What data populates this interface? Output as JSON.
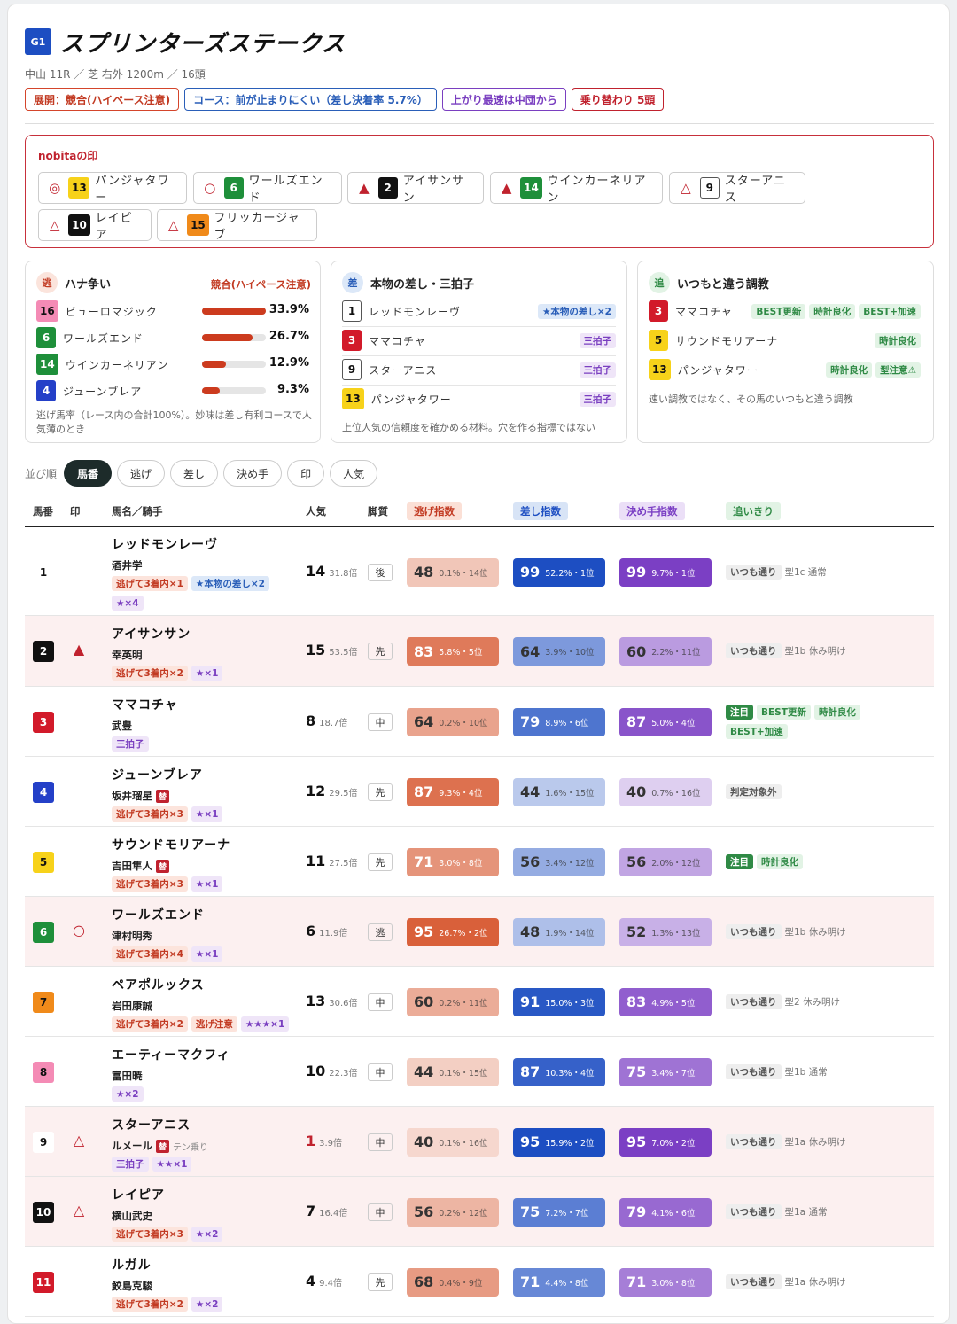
{
  "race": {
    "grade": "G1",
    "title": "スプリンターズステークス",
    "sub": "中山 11R ／ 芝 右外 1200m ／ 16頭"
  },
  "badges": [
    {
      "label": "展開：競合(ハイペース注意)"
    },
    {
      "label": "コース：前が止まりにくい（差し決着率 5.7%）"
    },
    {
      "label": "上がり最速は中団から"
    },
    {
      "label": "乗り替わり 5頭"
    }
  ],
  "marks": {
    "title": "nobitaの印",
    "items": [
      {
        "sym": "◎",
        "no": "13",
        "name": "パンジャタワー"
      },
      {
        "sym": "○",
        "no": "6",
        "name": "ワールズエンド"
      },
      {
        "sym": "▲",
        "no": "2",
        "name": "アイサンサン"
      },
      {
        "sym": "▲",
        "no": "14",
        "name": "ウインカーネリアン"
      },
      {
        "sym": "△",
        "no": "9",
        "name": "スターアニス"
      },
      {
        "sym": "△",
        "no": "10",
        "name": "レイピア"
      },
      {
        "sym": "△",
        "no": "15",
        "name": "フリッカージャブ"
      }
    ]
  },
  "card1": {
    "icon": "逃",
    "title": "ハナ争い",
    "status": "競合(ハイペース注意)",
    "rows": [
      {
        "no": "16",
        "name": "ビューロマジック",
        "pct": "33.9%",
        "v": 0.339
      },
      {
        "no": "6",
        "name": "ワールズエンド",
        "pct": "26.7%",
        "v": 0.267
      },
      {
        "no": "14",
        "name": "ウインカーネリアン",
        "pct": "12.9%",
        "v": 0.129
      },
      {
        "no": "4",
        "name": "ジューンブレア",
        "pct": "9.3%",
        "v": 0.093
      }
    ],
    "note": "逃げ馬率（レース内の合計100%）。妙味は差し有利コースで人気薄のとき"
  },
  "card2": {
    "icon": "差",
    "title": "本物の差し・三拍子",
    "rows": [
      {
        "no": "1",
        "name": "レッドモンレーヴ",
        "tag": "★本物の差し×2"
      },
      {
        "no": "3",
        "name": "ママコチャ",
        "tag": "三拍子"
      },
      {
        "no": "9",
        "name": "スターアニス",
        "tag": "三拍子"
      },
      {
        "no": "13",
        "name": "パンジャタワー",
        "tag": "三拍子"
      }
    ],
    "note": "上位人気の信頼度を確かめる材料。穴を作る指標ではない"
  },
  "card3": {
    "icon": "追",
    "title": "いつもと違う調教",
    "rows": [
      {
        "no": "3",
        "name": "ママコチャ",
        "tags": [
          "BEST更新",
          "時計良化",
          "BEST+加速"
        ]
      },
      {
        "no": "5",
        "name": "サウンドモリアーナ",
        "tags": [
          "時計良化"
        ]
      },
      {
        "no": "13",
        "name": "パンジャタワー",
        "tags": [
          "時計良化",
          "型注意⚠"
        ]
      }
    ],
    "note": "速い調教ではなく、その馬のいつもと違う調教"
  },
  "sort": {
    "label": "並び順",
    "options": [
      "馬番",
      "逃げ",
      "差し",
      "決め手",
      "印",
      "人気"
    ]
  },
  "table": {
    "headers": {
      "no": "馬番",
      "mark": "印",
      "name": "馬名／騎手",
      "pop": "人気",
      "leg": "脚質",
      "nige": "逃げ指数",
      "sashi": "差し指数",
      "kime": "決め手指数",
      "oi": "追いきり"
    },
    "rows": [
      {
        "no": "1",
        "mark": "",
        "name": "レッドモンレーヴ",
        "jockey": "酒井学",
        "chg": "",
        "jnote": "",
        "tags": [
          [
            "逃げて3着内×1",
            "o"
          ],
          [
            "★本物の差し×2",
            "b"
          ],
          [
            "★×4",
            "p"
          ]
        ],
        "pop": "14",
        "odds": "31.8倍",
        "leg": "後",
        "nige": [
          "48",
          "0.1%・14位",
          0.48
        ],
        "sashi": [
          "99",
          "52.2%・1位",
          0.99
        ],
        "kime": [
          "99",
          "9.7%・1位",
          0.99
        ],
        "oi": [
          [
            "いつも通り",
            "g"
          ]
        ],
        "oinote": "型1c 通常"
      },
      {
        "no": "2",
        "mark": "▲",
        "name": "アイサンサン",
        "jockey": "幸英明",
        "chg": "",
        "jnote": "",
        "tags": [
          [
            "逃げて3着内×2",
            "o"
          ],
          [
            "★×1",
            "p"
          ]
        ],
        "pop": "15",
        "odds": "53.5倍",
        "leg": "先",
        "nige": [
          "83",
          "5.8%・5位",
          0.83
        ],
        "sashi": [
          "64",
          "3.9%・10位",
          0.64
        ],
        "kime": [
          "60",
          "2.2%・11位",
          0.6
        ],
        "oi": [
          [
            "いつも通り",
            "g"
          ]
        ],
        "oinote": "型1b 休み明け"
      },
      {
        "no": "3",
        "mark": "",
        "name": "ママコチャ",
        "jockey": "武豊",
        "chg": "",
        "jnote": "",
        "tags": [
          [
            "三拍子",
            "p"
          ]
        ],
        "pop": "8",
        "odds": "18.7倍",
        "leg": "中",
        "nige": [
          "64",
          "0.2%・10位",
          0.64
        ],
        "sashi": [
          "79",
          "8.9%・6位",
          0.79
        ],
        "kime": [
          "87",
          "5.0%・4位",
          0.87
        ],
        "oi": [
          [
            "注目",
            "G"
          ],
          [
            "BEST更新",
            "gr"
          ],
          [
            "時計良化",
            "gr"
          ],
          [
            "BEST+加速",
            "gr"
          ]
        ],
        "oinote": ""
      },
      {
        "no": "4",
        "mark": "",
        "name": "ジューンブレア",
        "jockey": "坂井瑠星",
        "chg": "替",
        "jnote": "",
        "tags": [
          [
            "逃げて3着内×3",
            "o"
          ],
          [
            "★×1",
            "p"
          ]
        ],
        "pop": "12",
        "odds": "29.5倍",
        "leg": "先",
        "nige": [
          "87",
          "9.3%・4位",
          0.87
        ],
        "sashi": [
          "44",
          "1.6%・15位",
          0.44
        ],
        "kime": [
          "40",
          "0.7%・16位",
          0.4
        ],
        "oi": [
          [
            "判定対象外",
            "g"
          ]
        ],
        "oinote": ""
      },
      {
        "no": "5",
        "mark": "",
        "name": "サウンドモリアーナ",
        "jockey": "吉田隼人",
        "chg": "替",
        "jnote": "",
        "tags": [
          [
            "逃げて3着内×3",
            "o"
          ],
          [
            "★×1",
            "p"
          ]
        ],
        "pop": "11",
        "odds": "27.5倍",
        "leg": "先",
        "nige": [
          "71",
          "3.0%・8位",
          0.71
        ],
        "sashi": [
          "56",
          "3.4%・12位",
          0.56
        ],
        "kime": [
          "56",
          "2.0%・12位",
          0.56
        ],
        "oi": [
          [
            "注目",
            "G"
          ],
          [
            "時計良化",
            "gr"
          ]
        ],
        "oinote": ""
      },
      {
        "no": "6",
        "mark": "○",
        "name": "ワールズエンド",
        "jockey": "津村明秀",
        "chg": "",
        "jnote": "",
        "tags": [
          [
            "逃げて3着内×4",
            "o"
          ],
          [
            "★×1",
            "p"
          ]
        ],
        "pop": "6",
        "odds": "11.9倍",
        "leg": "逃",
        "nige": [
          "95",
          "26.7%・2位",
          0.95
        ],
        "sashi": [
          "48",
          "1.9%・14位",
          0.48
        ],
        "kime": [
          "52",
          "1.3%・13位",
          0.52
        ],
        "oi": [
          [
            "いつも通り",
            "g"
          ]
        ],
        "oinote": "型1b 休み明け"
      },
      {
        "no": "7",
        "mark": "",
        "name": "ペアポルックス",
        "jockey": "岩田康誠",
        "chg": "",
        "jnote": "",
        "tags": [
          [
            "逃げて3着内×2",
            "o"
          ],
          [
            "逃げ注意",
            "o"
          ],
          [
            "★★★×1",
            "p"
          ]
        ],
        "pop": "13",
        "odds": "30.6倍",
        "leg": "中",
        "nige": [
          "60",
          "0.2%・11位",
          0.6
        ],
        "sashi": [
          "91",
          "15.0%・3位",
          0.91
        ],
        "kime": [
          "83",
          "4.9%・5位",
          0.83
        ],
        "oi": [
          [
            "いつも通り",
            "g"
          ]
        ],
        "oinote": "型2 休み明け"
      },
      {
        "no": "8",
        "mark": "",
        "name": "エーティーマクフィ",
        "jockey": "富田暁",
        "chg": "",
        "jnote": "",
        "tags": [
          [
            "★×2",
            "p"
          ]
        ],
        "pop": "10",
        "odds": "22.3倍",
        "leg": "中",
        "nige": [
          "44",
          "0.1%・15位",
          0.44
        ],
        "sashi": [
          "87",
          "10.3%・4位",
          0.87
        ],
        "kime": [
          "75",
          "3.4%・7位",
          0.75
        ],
        "oi": [
          [
            "いつも通り",
            "g"
          ]
        ],
        "oinote": "型1b 通常"
      },
      {
        "no": "9",
        "mark": "△",
        "name": "スターアニス",
        "jockey": "ルメール",
        "chg": "替",
        "jnote": "テン乗り",
        "tags": [
          [
            "三拍子",
            "p"
          ],
          [
            "★★×1",
            "p"
          ]
        ],
        "pop": "1",
        "odds": "3.9倍",
        "leg": "中",
        "nige": [
          "40",
          "0.1%・16位",
          0.4
        ],
        "sashi": [
          "95",
          "15.9%・2位",
          0.95
        ],
        "kime": [
          "95",
          "7.0%・2位",
          0.95
        ],
        "oi": [
          [
            "いつも通り",
            "g"
          ]
        ],
        "oinote": "型1a 休み明け"
      },
      {
        "no": "10",
        "mark": "△",
        "name": "レイピア",
        "jockey": "横山武史",
        "chg": "",
        "jnote": "",
        "tags": [
          [
            "逃げて3着内×3",
            "o"
          ],
          [
            "★×2",
            "p"
          ]
        ],
        "pop": "7",
        "odds": "16.4倍",
        "leg": "中",
        "nige": [
          "56",
          "0.2%・12位",
          0.56
        ],
        "sashi": [
          "75",
          "7.2%・7位",
          0.75
        ],
        "kime": [
          "79",
          "4.1%・6位",
          0.79
        ],
        "oi": [
          [
            "いつも通り",
            "g"
          ]
        ],
        "oinote": "型1a 通常"
      },
      {
        "no": "11",
        "mark": "",
        "name": "ルガル",
        "jockey": "鮫島克駿",
        "chg": "",
        "jnote": "",
        "tags": [
          [
            "逃げて3着内×2",
            "o"
          ],
          [
            "★×2",
            "p"
          ]
        ],
        "pop": "4",
        "odds": "9.4倍",
        "leg": "先",
        "nige": [
          "68",
          "0.4%・9位",
          0.68
        ],
        "sashi": [
          "71",
          "4.4%・8位",
          0.71
        ],
        "kime": [
          "71",
          "3.0%・8位",
          0.71
        ],
        "oi": [
          [
            "いつも通り",
            "g"
          ]
        ],
        "oinote": "型1a 休み明け"
      }
    ]
  },
  "colors": {
    "accent": "#c0222e",
    "nige": "#d9603a",
    "sashi": "#1d4ec2",
    "kime": "#7b3fc4"
  }
}
